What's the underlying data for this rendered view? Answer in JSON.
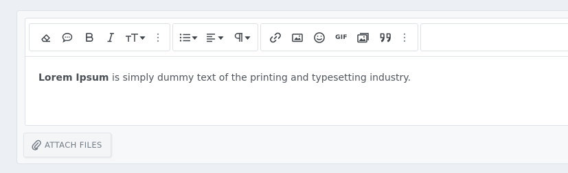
{
  "toolbar": {
    "groups": [
      {
        "name": "text-format",
        "buttons": [
          "eraser-icon",
          "speech-bubble-icon",
          "bold-icon",
          "italic-icon",
          "text-size-icon",
          "more-options-icon"
        ]
      },
      {
        "name": "paragraph",
        "buttons": [
          "bulleted-list-icon",
          "align-left-icon",
          "paragraph-icon"
        ]
      },
      {
        "name": "insert",
        "buttons": [
          "link-icon",
          "image-icon",
          "smile-icon",
          "gif-icon",
          "media-gallery-icon",
          "quote-icon",
          "more-options-icon"
        ]
      }
    ],
    "gif_label": "GIF"
  },
  "content": {
    "bold_text": "Lorem Ipsum",
    "rest_text": " is simply dummy text of the printing and typesetting industry."
  },
  "attach": {
    "label": "ATTACH FILES"
  },
  "colors": {
    "page_bg": "#eceff4",
    "editor_bg": "#ffffff",
    "icon": "#3d4248",
    "text": "#50565d"
  }
}
